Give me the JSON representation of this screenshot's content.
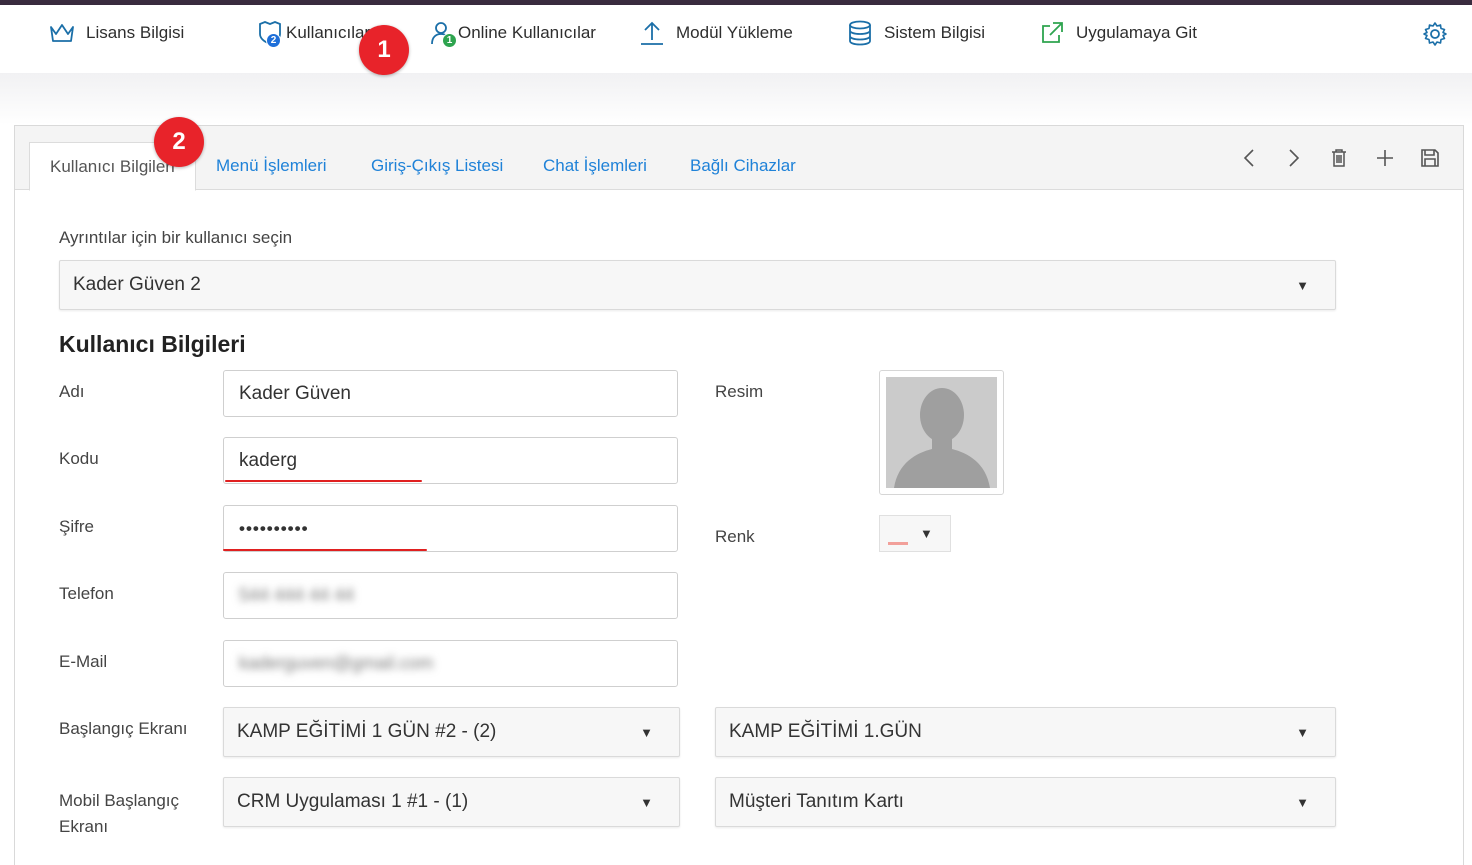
{
  "nav": {
    "items": [
      {
        "label": "Lisans Bilgisi",
        "icon": "crown-icon"
      },
      {
        "label": "Kullanıcılar",
        "icon": "shield-users-icon",
        "badge": "2"
      },
      {
        "label": "Online Kullanıcılar",
        "icon": "user-online-icon",
        "badge": "1"
      },
      {
        "label": "Modül Yükleme",
        "icon": "upload-icon"
      },
      {
        "label": "Sistem Bilgisi",
        "icon": "database-icon"
      },
      {
        "label": "Uygulamaya Git",
        "icon": "external-link-icon"
      }
    ],
    "settings_icon": "gear-icon"
  },
  "callouts": [
    "1",
    "2"
  ],
  "tabs": [
    {
      "label": "Kullanıcı Bilgileri",
      "active": true
    },
    {
      "label": "Menü İşlemleri"
    },
    {
      "label": "Giriş-Çıkış Listesi"
    },
    {
      "label": "Chat İşlemleri"
    },
    {
      "label": "Bağlı Cihazlar"
    }
  ],
  "toolbar": [
    "chevron-left-icon",
    "chevron-right-icon",
    "trash-icon",
    "plus-icon",
    "save-icon"
  ],
  "user_select": {
    "label": "Ayrıntılar için bir kullanıcı seçin",
    "value": "Kader Güven 2"
  },
  "section_title": "Kullanıcı Bilgileri",
  "fields": {
    "name": {
      "label": "Adı",
      "value": "Kader Güven"
    },
    "code": {
      "label": "Kodu",
      "value": "kaderg"
    },
    "password": {
      "label": "Şifre",
      "value": "••••••••••"
    },
    "phone": {
      "label": "Telefon",
      "value": "544 444 44 44"
    },
    "email": {
      "label": "E-Mail",
      "value": "kaderguven@gmail.com"
    },
    "image": {
      "label": "Resim"
    },
    "color": {
      "label": "Renk",
      "value": "#f2a09a"
    },
    "start_screen": {
      "label": "Başlangıç Ekranı",
      "value": "KAMP EĞİTİMİ 1 GÜN #2 - (2)",
      "value2": "KAMP EĞİTİMİ 1.GÜN"
    },
    "mobile_start_screen": {
      "label": "Mobil Başlangıç Ekranı",
      "value": "CRM Uygulaması 1 #1 - (1)",
      "value2": "Müşteri Tanıtım Kartı"
    }
  }
}
